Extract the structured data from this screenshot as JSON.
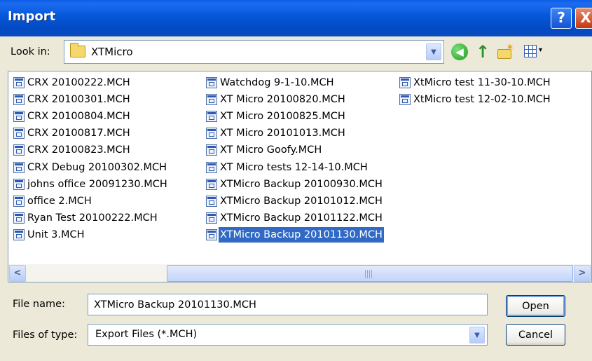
{
  "window": {
    "title": "Import",
    "help_glyph": "?",
    "close_glyph": "X"
  },
  "toolbar": {
    "lookin_label": "Look in:",
    "lookin_value": "XTMicro",
    "back_glyph": "◀",
    "up_glyph": "↑",
    "newfolder_glyph": "✶",
    "views_caret": "▾",
    "dropdown_glyph": "▼",
    "icons": [
      "folder-icon",
      "back-icon",
      "up-folder-icon",
      "new-folder-icon",
      "views-menu-icon"
    ]
  },
  "file_list": {
    "columns": [
      [
        "CRX 20100222.MCH",
        "CRX 20100301.MCH",
        "CRX 20100804.MCH",
        "CRX 20100817.MCH",
        "CRX 20100823.MCH",
        "CRX Debug 20100302.MCH",
        "johns office 20091230.MCH",
        "office 2.MCH",
        "Ryan Test 20100222.MCH",
        "Unit 3.MCH"
      ],
      [
        "Watchdog 9-1-10.MCH",
        "XT Micro 20100820.MCH",
        "XT Micro 20100825.MCH",
        "XT Micro 20101013.MCH",
        "XT Micro Goofy.MCH",
        "XT Micro tests 12-14-10.MCH",
        "XTMicro Backup 20100930.MCH",
        "XTMicro Backup 20101012.MCH",
        "XTMicro Backup 20101122.MCH",
        "XTMicro Backup 20101130.MCH"
      ],
      [
        "XtMicro test 11-30-10.MCH",
        "XtMicro test 12-02-10.MCH"
      ]
    ],
    "selected": "XTMicro Backup 20101130.MCH",
    "scroll_left_glyph": "<",
    "scroll_right_glyph": ">"
  },
  "file_name": {
    "label": "File name:",
    "value": "XTMicro Backup 20101130.MCH"
  },
  "file_type": {
    "label": "Files of type:",
    "value": "Export Files (*.MCH)"
  },
  "buttons": {
    "open": "Open",
    "cancel": "Cancel"
  },
  "colors": {
    "titlebar": "#0457d8",
    "selection": "#316ac5",
    "dialog_bg": "#ece9d8"
  }
}
